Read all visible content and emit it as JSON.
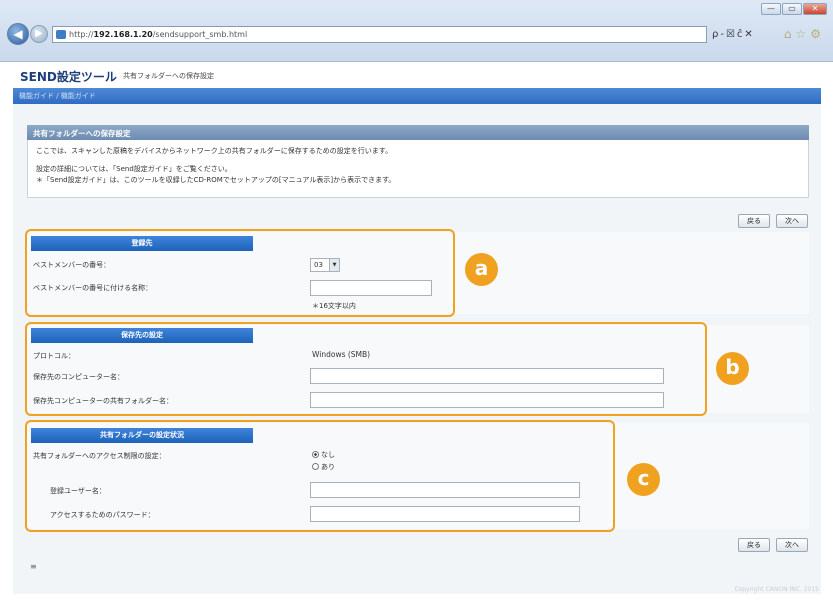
{
  "browser": {
    "address_prefix": "http://",
    "address_host": "192.168.1.20",
    "address_path": "/sendsupport_smb.html",
    "addr_tools": "ρ-☒ĉ✕",
    "fav_tools": "⌂☆⚙",
    "window_buttons": {
      "minimize": "—",
      "maximize": "▭",
      "close": "✕"
    },
    "back_glyph": "◀",
    "forward_glyph": "▶"
  },
  "header": {
    "title": "SEND設定ツール",
    "subtitle": "共有フォルダーへの保存設定"
  },
  "breadcrumb": "機能ガイド / 機能ガイド",
  "intro": {
    "title": "共有フォルダーへの保存設定",
    "line1": "ここでは、スキャンした原稿をデバイスからネットワーク上の共有フォルダーに保存するための設定を行います。",
    "line2": "設定の詳細については、「Send設定ガイド」をご覧ください。",
    "line3": "＊「Send設定ガイド」は、このツールを収録したCD-ROMでセットアップの[マニュアル表示]から表示できます。"
  },
  "buttons": {
    "back": "戻る",
    "next": "次へ"
  },
  "section_a": {
    "badge": "a",
    "title": "登録先",
    "member_number_label": "ベストメンバーの番号：",
    "member_number_value": "03",
    "member_name_label": "ベストメンバーの番号に付ける名称：",
    "member_name_value": "",
    "member_name_hint": "＊16文字以内"
  },
  "section_b": {
    "badge": "b",
    "title": "保存先の設定",
    "protocol_label": "プロトコル：",
    "protocol_value": "Windows (SMB)",
    "computer_name_label": "保存先のコンピューター名：",
    "computer_name_value": "",
    "shared_folder_label": "保存先コンピューターの共有フォルダー名：",
    "shared_folder_value": ""
  },
  "section_c": {
    "badge": "c",
    "title": "共有フォルダーの設定状況",
    "access_restriction_label": "共有フォルダーへのアクセス制限の設定：",
    "option_none": "なし",
    "option_yes": "あり",
    "selected": "なし",
    "username_label": "登録ユーザー名：",
    "username_value": "",
    "password_label": "アクセスするためのパスワード：",
    "password_value": ""
  },
  "footer": {
    "mark": "≡",
    "copyright": "Copyright CANON INC. 2015"
  }
}
